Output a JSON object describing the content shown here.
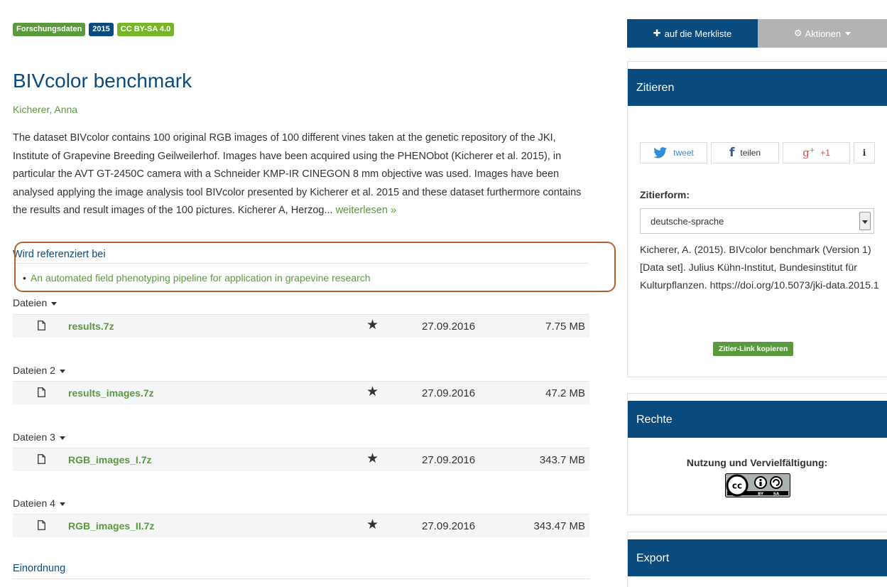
{
  "badges": [
    "Forschungsdaten",
    "2015",
    "CC BY-SA 4.0"
  ],
  "title": "BIVcolor benchmark",
  "author": "Kicherer, Anna",
  "description": "The dataset BIVcolor contains 100 original RGB images of 100 different vines taken at the genetic repository of the JKI, Institute of Grapevine Breeding Geilweilerhof. Images have been acquired using the PHENObot (Kicherer et al. 2015), in particular the AVT GT-2450C camera with a Schneider KMP-IR CINEGON 8 mm objective was used. Images have been analysed applying the image analysis tool BIVcolor presented by Kicherer et al. 2015 and these dataset furthermore contains the results and result images of the 100 pictures. Kicherer A, Herzog...",
  "read_more": "weiterlesen »",
  "references": {
    "heading": "Wird referenziert bei",
    "items": [
      "An automated field phenotyping pipeline for application in grapevine research"
    ]
  },
  "file_groups": [
    {
      "label": "Dateien",
      "name": "results.7z",
      "date": "27.09.2016",
      "size": "7.75 MB"
    },
    {
      "label": "Dateien 2",
      "name": "results_images.7z",
      "date": "27.09.2016",
      "size": "47.2 MB"
    },
    {
      "label": "Dateien 3",
      "name": "RGB_images_I.7z",
      "date": "27.09.2016",
      "size": "343.7 MB"
    },
    {
      "label": "Dateien 4",
      "name": "RGB_images_II.7z",
      "date": "27.09.2016",
      "size": "343.47 MB"
    }
  ],
  "einordnung": "Einordnung",
  "sidebar": {
    "merkliste": "auf die Merkliste",
    "aktionen": "Aktionen",
    "zitieren": {
      "heading": "Zitieren",
      "tweet": "tweet",
      "teilen": "teilen",
      "plusone": "+1",
      "info": "i",
      "zitierform_label": "Zitierform:",
      "zitierform_value": "deutsche-sprache",
      "citation": "Kicherer, A. (2015). BIVcolor benchmark (Version 1) [Data set]. Julius Kühn-Institut, Bundesinstitut für Kulturpflanzen. https://doi.org/10.5073/jki-data.2015.1",
      "copy_button": "Zitier-Link kopieren"
    },
    "rechte": {
      "heading": "Rechte",
      "nutzung": "Nutzung und Vervielfältigung:",
      "license_logo": "cc-by-sa-logo"
    },
    "export": {
      "heading": "Export"
    }
  },
  "colors": {
    "navy": "#0a4a7c",
    "green": "#5b9a3c",
    "lime": "#78b42a",
    "grey_button": "#b3b3b3",
    "highlight_border": "#b4622a"
  }
}
